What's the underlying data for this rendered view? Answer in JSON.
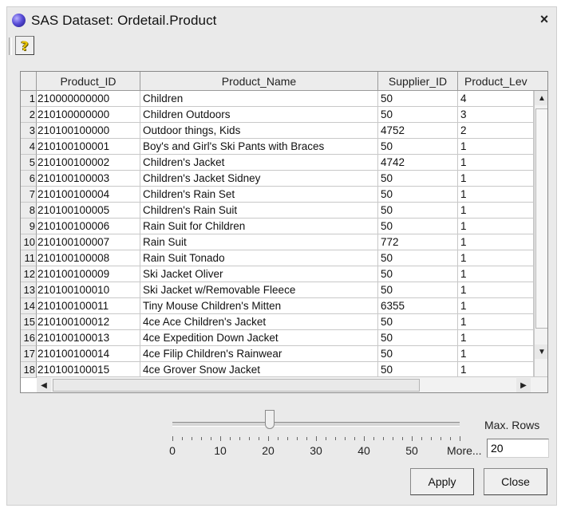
{
  "window": {
    "title": "SAS Dataset: Ordetail.Product",
    "close_glyph": "×"
  },
  "toolbar": {
    "help_icon": "help-question-icon",
    "help_glyph": "?"
  },
  "table": {
    "columns": [
      "Product_ID",
      "Product_Name",
      "Supplier_ID",
      "Product_Lev"
    ],
    "rows": [
      {
        "n": "1",
        "id": "210000000000",
        "name": "Children",
        "supplier": "50",
        "level": "4"
      },
      {
        "n": "2",
        "id": "210100000000",
        "name": "Children Outdoors",
        "supplier": "50",
        "level": "3"
      },
      {
        "n": "3",
        "id": "210100100000",
        "name": "Outdoor things, Kids",
        "supplier": "4752",
        "level": "2"
      },
      {
        "n": "4",
        "id": "210100100001",
        "name": "Boy's and Girl's Ski Pants with Braces",
        "supplier": "50",
        "level": "1"
      },
      {
        "n": "5",
        "id": "210100100002",
        "name": "Children's Jacket",
        "supplier": "4742",
        "level": "1"
      },
      {
        "n": "6",
        "id": "210100100003",
        "name": "Children's Jacket Sidney",
        "supplier": "50",
        "level": "1"
      },
      {
        "n": "7",
        "id": "210100100004",
        "name": "Children's Rain Set",
        "supplier": "50",
        "level": "1"
      },
      {
        "n": "8",
        "id": "210100100005",
        "name": "Children's Rain Suit",
        "supplier": "50",
        "level": "1"
      },
      {
        "n": "9",
        "id": "210100100006",
        "name": "Rain Suit for Children",
        "supplier": "50",
        "level": "1"
      },
      {
        "n": "10",
        "id": "210100100007",
        "name": "Rain Suit",
        "supplier": "772",
        "level": "1"
      },
      {
        "n": "11",
        "id": "210100100008",
        "name": "Rain Suit Tonado",
        "supplier": "50",
        "level": "1"
      },
      {
        "n": "12",
        "id": "210100100009",
        "name": "Ski Jacket Oliver",
        "supplier": "50",
        "level": "1"
      },
      {
        "n": "13",
        "id": "210100100010",
        "name": "Ski Jacket w/Removable Fleece",
        "supplier": "50",
        "level": "1"
      },
      {
        "n": "14",
        "id": "210100100011",
        "name": "Tiny Mouse Children's Mitten",
        "supplier": "6355",
        "level": "1"
      },
      {
        "n": "15",
        "id": "210100100012",
        "name": "4ce Ace Children's Jacket",
        "supplier": "50",
        "level": "1"
      },
      {
        "n": "16",
        "id": "210100100013",
        "name": "4ce Expedition Down Jacket",
        "supplier": "50",
        "level": "1"
      },
      {
        "n": "17",
        "id": "210100100014",
        "name": "4ce Filip Children's Rainwear",
        "supplier": "50",
        "level": "1"
      },
      {
        "n": "18",
        "id": "210100100015",
        "name": "4ce Grover Snow Jacket",
        "supplier": "50",
        "level": "1"
      }
    ]
  },
  "scrollbars": {
    "up": "▲",
    "down": "▼",
    "left": "◀",
    "right": "▶"
  },
  "slider": {
    "labels": [
      "0",
      "10",
      "20",
      "30",
      "40",
      "50",
      "More..."
    ],
    "value": 20
  },
  "max_rows": {
    "label": "Max. Rows",
    "value": "20"
  },
  "buttons": {
    "apply": "Apply",
    "close": "Close"
  }
}
